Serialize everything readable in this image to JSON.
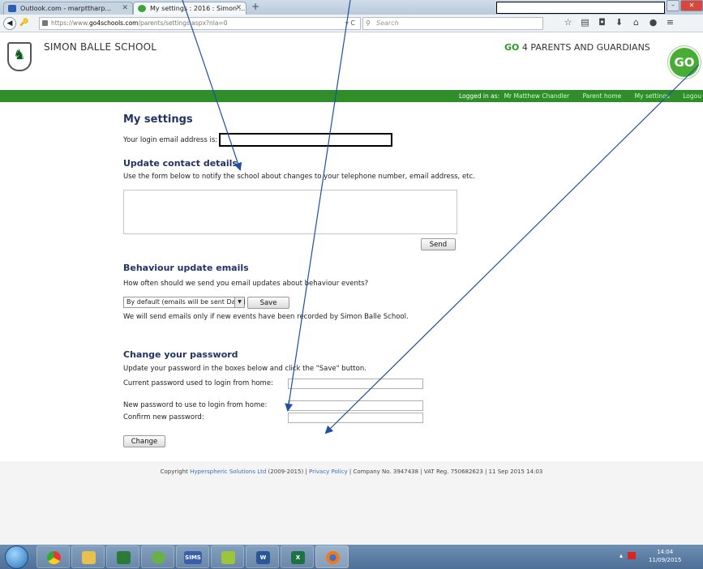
{
  "browser": {
    "tabs": [
      {
        "label": "Outlook.com - marpttharp...",
        "fav_color": "#2a5fb0"
      },
      {
        "label": "My settings : 2016 : Simon ...",
        "fav_color": "#3aa53a"
      }
    ],
    "new_tab": "+",
    "url_prefix": "https://www.",
    "url_domain": "go4schools.com",
    "url_path": "/parents/settings.aspx?nla=0",
    "search_placeholder": "Search",
    "reload_glyph": "▿ C"
  },
  "site": {
    "school_name": "SIMON BALLE SCHOOL",
    "portal_prefix": "GO",
    "portal_title": "4 PARENTS AND GUARDIANS",
    "logo_text": "GO",
    "nav": {
      "logged_in_label": "Logged in as:",
      "user": "Mr Matthew Chandler",
      "parent_home": "Parent home",
      "my_settings": "My settings",
      "logout": "Logou"
    }
  },
  "settings": {
    "title": "My settings",
    "login_email_label": "Your login email address is:",
    "contact": {
      "heading": "Update contact details",
      "description": "Use the form below to notify the school about changes to your telephone number, email address, etc.",
      "send_label": "Send"
    },
    "behaviour": {
      "heading": "Behaviour update emails",
      "question": "How often should we send you email updates about behaviour events?",
      "selected_option": "By default (emails will be sent Daily)",
      "save_label": "Save",
      "note": "We will send emails only if new events have been recorded by Simon Balle School."
    },
    "password": {
      "heading": "Change your password",
      "instructions": "Update your password in the boxes below and click the \"Save\" button.",
      "current_label": "Current password used to login from home:",
      "new_label": "New password to use to login from home:",
      "confirm_label": "Confirm new password:",
      "change_label": "Change"
    }
  },
  "footer": {
    "prefix": "Copyright ",
    "company": "Hyperspheric Solutions Ltd",
    "years": " (2009-2015) | ",
    "privacy": "Privacy Policy",
    "rest": " | Company No. 3947438 | VAT Reg. 750682623 | 11 Sep 2015 14:03"
  },
  "taskbar": {
    "time": "14:04",
    "date": "11/09/2015",
    "sims_label": "SIMS",
    "word_label": "W",
    "excel_label": "X"
  }
}
